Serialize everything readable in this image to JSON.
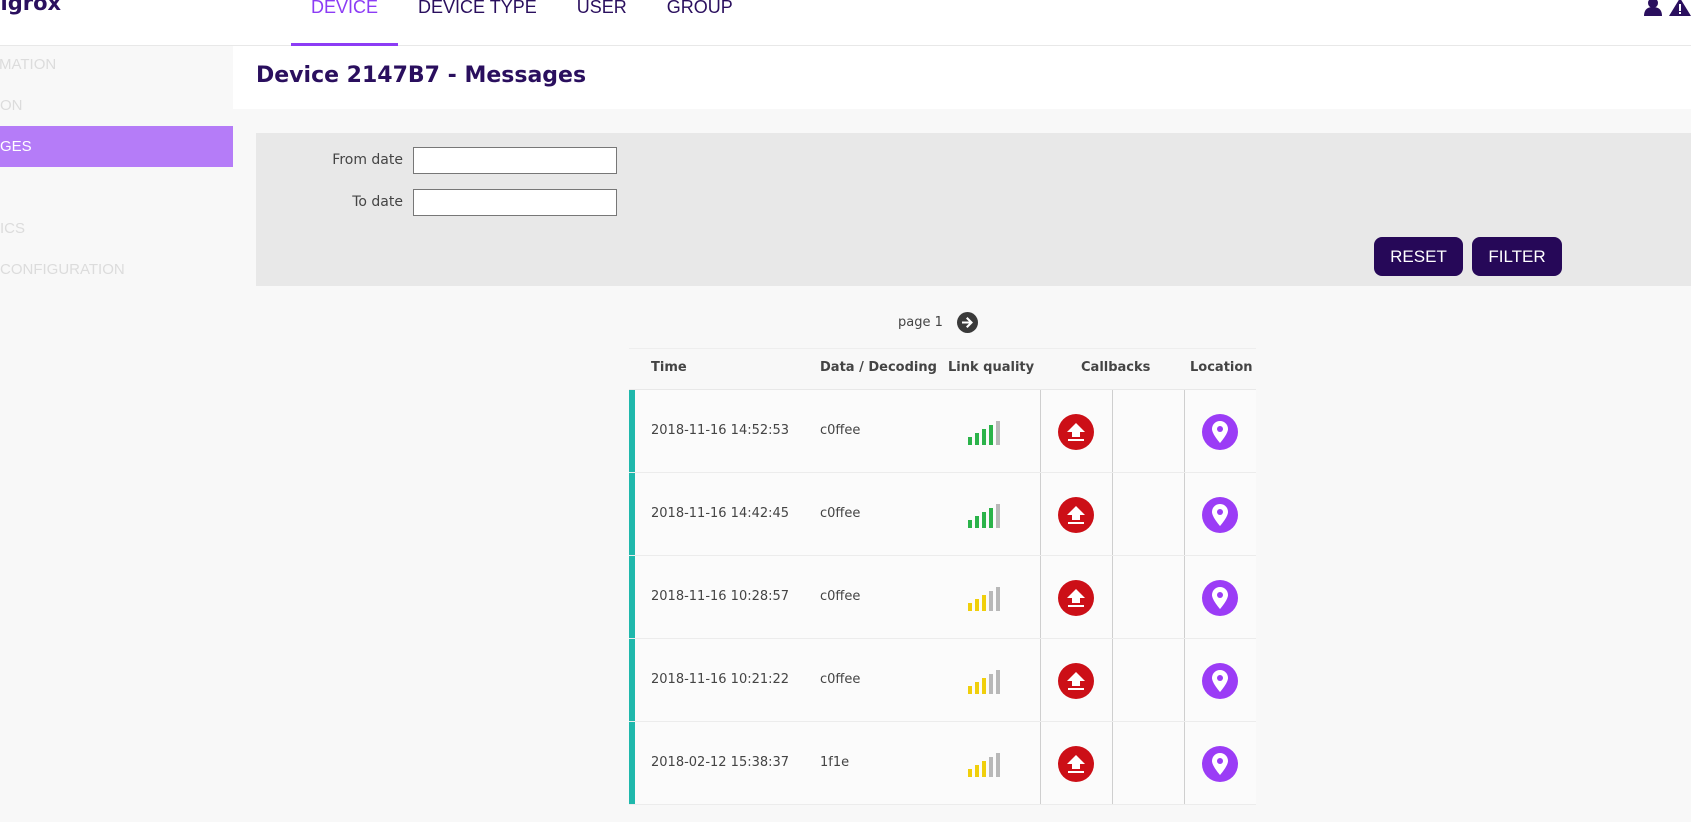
{
  "brand": "sigrox",
  "nav": [
    "DEVICE",
    "DEVICE TYPE",
    "USER",
    "GROUP"
  ],
  "sidebar": [
    "MATION",
    "ON",
    "GES",
    "",
    "ICS",
    "CONFIGURATION"
  ],
  "page_title": "Device 2147B7 - Messages",
  "filter": {
    "from_label": "From date",
    "to_label": "To date",
    "from_value": "",
    "to_value": "",
    "reset_label": "RESET",
    "filter_label": "FILTER"
  },
  "pager": {
    "label": "page 1"
  },
  "table": {
    "headers": {
      "time": "Time",
      "data": "Data / Decoding",
      "link": "Link quality",
      "callbacks": "Callbacks",
      "location": "Location"
    },
    "rows": [
      {
        "time": "2018-11-16 14:52:53",
        "data": "c0ffee",
        "link_level": 4,
        "link_color": "#2bb34a"
      },
      {
        "time": "2018-11-16 14:42:45",
        "data": "c0ffee",
        "link_level": 4,
        "link_color": "#2bb34a"
      },
      {
        "time": "2018-11-16 10:28:57",
        "data": "c0ffee",
        "link_level": 3,
        "link_color": "#f0cf0c"
      },
      {
        "time": "2018-11-16 10:21:22",
        "data": "c0ffee",
        "link_level": 3,
        "link_color": "#f0cf0c"
      },
      {
        "time": "2018-02-12 15:38:37",
        "data": "1f1e",
        "link_level": 3,
        "link_color": "#f0cf0c"
      }
    ]
  },
  "colors": {
    "primary": "#2a0f5e",
    "accent": "#8c3cf5",
    "sidebar_active": "#b57cf8",
    "row_accent": "#1fb8ac",
    "callback": "#cc0f17",
    "location": "#9b3cf6"
  },
  "icons": {
    "user": "user-icon",
    "warning": "warning-icon",
    "next": "arrow-right-circle-icon",
    "callback": "upload-icon",
    "location": "map-pin-icon"
  }
}
